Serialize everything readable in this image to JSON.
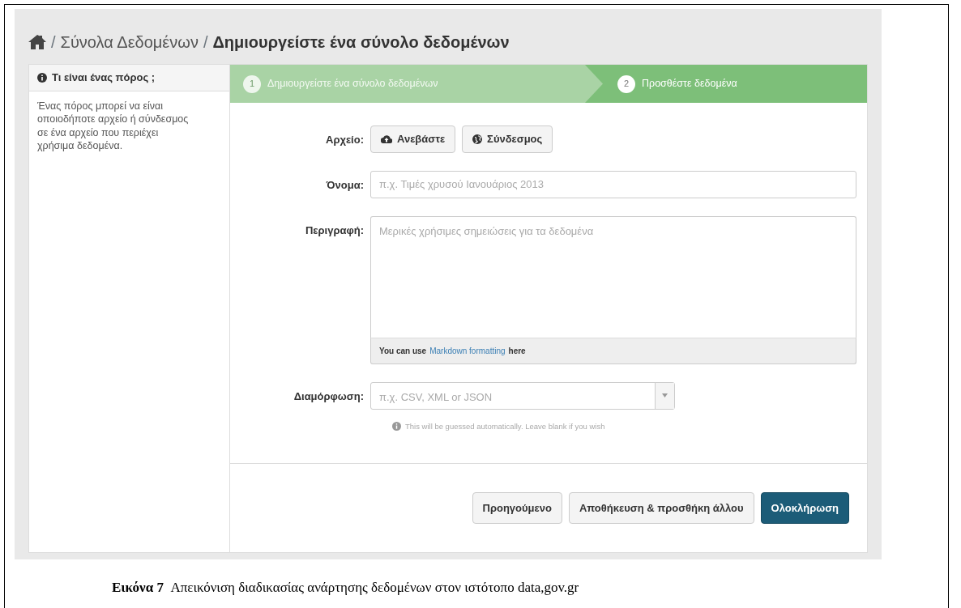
{
  "breadcrumb": [
    {
      "separator": "/",
      "label": "Σύνολα Δεδομένων",
      "current": false
    },
    {
      "separator": "/",
      "label": "Δημιουργείστε ένα σύνολο δεδομένων",
      "current": true
    }
  ],
  "sidebar": {
    "title": "Τι είναι ένας πόρος ;",
    "text": "Ένας πόρος μπορεί να είναι οποιοδήποτε αρχείο ή σύνδεσμος σε ένα αρχείο που περιέχει χρήσιμα δεδομένα."
  },
  "steps": [
    {
      "number": "1",
      "label": "Δημιουργείστε ένα σύνολο δεδομένων",
      "selected": false
    },
    {
      "number": "2",
      "label": "Προσθέστε δεδομένα",
      "selected": true
    }
  ],
  "file": {
    "label": "Αρχείο:",
    "buttons": [
      {
        "label": "Ανεβάστε",
        "kind": "upload"
      },
      {
        "label": "Σύνδεσμος",
        "kind": "link"
      }
    ]
  },
  "name": {
    "label": "Όνομα:",
    "placeholder": "π.χ. Τιμές χρυσού Ιανουάριος 2013"
  },
  "description": {
    "label": "Περιγραφή:",
    "placeholder": "Μερικές χρήσιμες σημειώσεις για τα δεδομένα",
    "hint_before": "You can use",
    "hint_link": "Markdown formatting",
    "hint_after": "here"
  },
  "format": {
    "label": "Διαμόρφωση:",
    "placeholder": "π.χ. CSV, XML or JSON",
    "help": "This will be guessed automatically. Leave blank if you wish"
  },
  "actions": [
    {
      "label": "Προηγούμενο",
      "kind": "default"
    },
    {
      "label": "Αποθήκευση & προσθήκη άλλου",
      "kind": "default"
    },
    {
      "label": "Ολοκλήρωση",
      "kind": "primary"
    }
  ],
  "caption": {
    "number": "Εικόνα 7",
    "text": "Απεικόνιση διαδικασίας ανάρτησης δεδομένων στον ιστότοπο data,gov.gr"
  }
}
